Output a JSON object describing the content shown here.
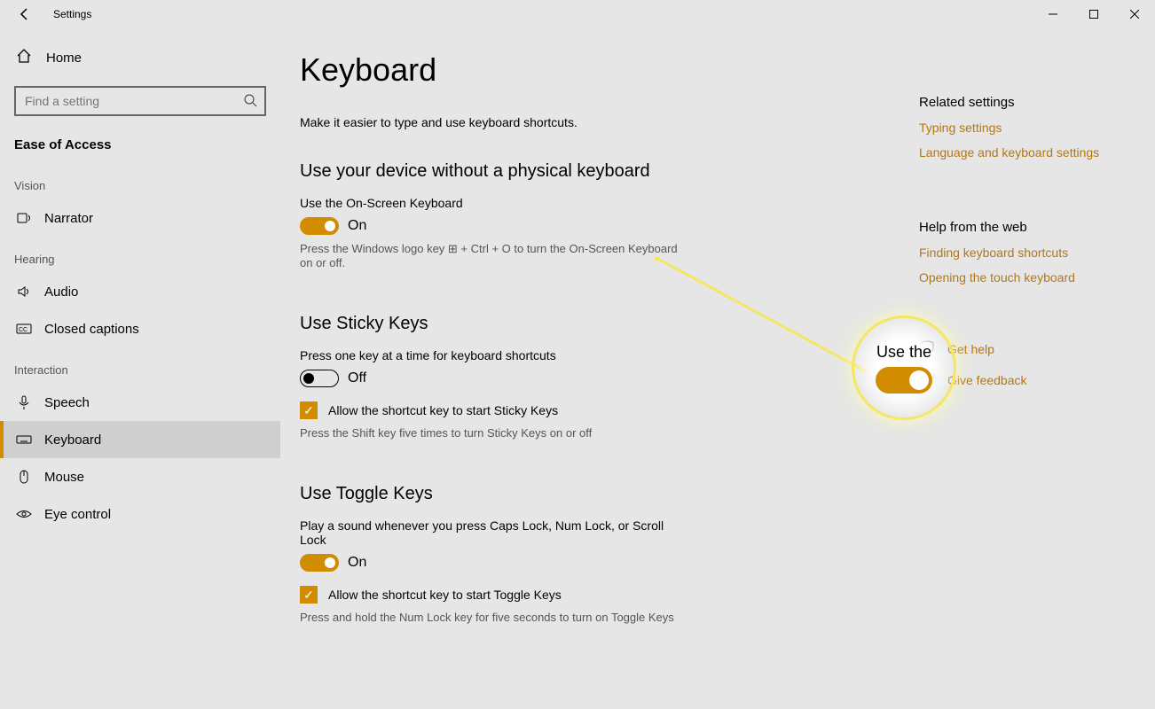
{
  "app": {
    "title": "Settings"
  },
  "sidebar": {
    "home": "Home",
    "search_placeholder": "Find a setting",
    "group": "Ease of Access",
    "sections": {
      "vision": {
        "title": "Vision",
        "items": [
          {
            "id": "narrator",
            "label": "Narrator"
          }
        ]
      },
      "hearing": {
        "title": "Hearing",
        "items": [
          {
            "id": "audio",
            "label": "Audio"
          },
          {
            "id": "closedcaptions",
            "label": "Closed captions"
          }
        ]
      },
      "interaction": {
        "title": "Interaction",
        "items": [
          {
            "id": "speech",
            "label": "Speech"
          },
          {
            "id": "keyboard",
            "label": "Keyboard",
            "active": true
          },
          {
            "id": "mouse",
            "label": "Mouse"
          },
          {
            "id": "eyecontrol",
            "label": "Eye control"
          }
        ]
      }
    }
  },
  "main": {
    "heading": "Keyboard",
    "lead": "Make it easier to type and use keyboard shortcuts.",
    "osk": {
      "heading": "Use your device without a physical keyboard",
      "label": "Use the On-Screen Keyboard",
      "state": "On",
      "on": true,
      "help": "Press the Windows logo key ⊞ + Ctrl + O to turn the On-Screen Keyboard on or off."
    },
    "sticky": {
      "heading": "Use Sticky Keys",
      "label": "Press one key at a time for keyboard shortcuts",
      "state": "Off",
      "on": false,
      "checkbox": "Allow the shortcut key to start Sticky Keys",
      "help": "Press the Shift key five times to turn Sticky Keys on or off"
    },
    "toggle": {
      "heading": "Use Toggle Keys",
      "label": "Play a sound whenever you press Caps Lock, Num Lock, or Scroll Lock",
      "state": "On",
      "on": true,
      "checkbox": "Allow the shortcut key to start Toggle Keys",
      "help": "Press and hold the Num Lock key for five seconds to turn on Toggle Keys"
    }
  },
  "right": {
    "related_title": "Related settings",
    "related_links": [
      "Typing settings",
      "Language and keyboard settings"
    ],
    "web_title": "Help from the web",
    "web_links": [
      "Finding keyboard shortcuts",
      "Opening the touch keyboard"
    ],
    "gethelp": "Get help",
    "feedback": "Give feedback"
  },
  "callout_text": "Use the"
}
